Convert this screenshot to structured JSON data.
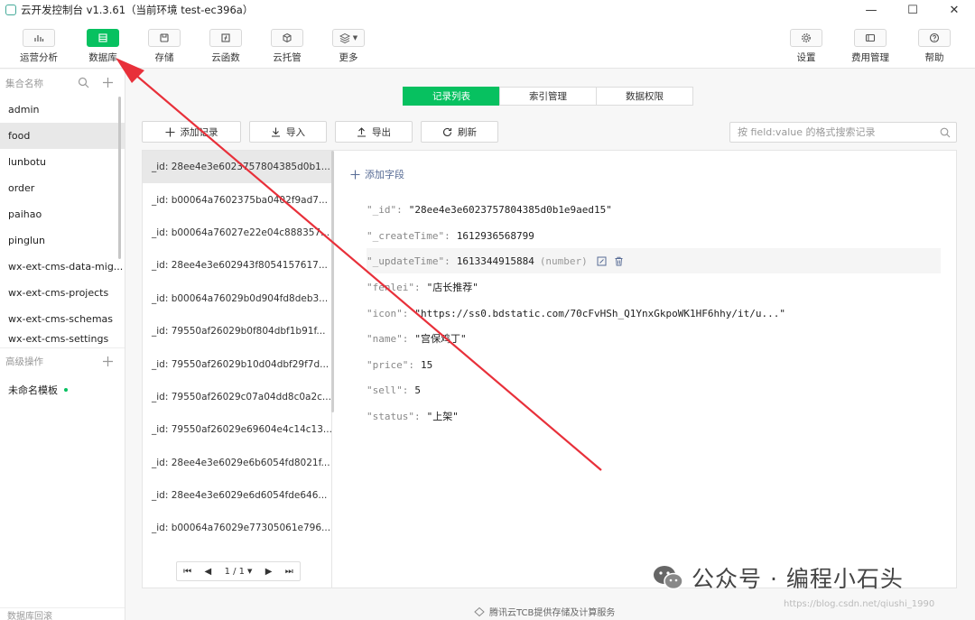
{
  "window": {
    "title": "云开发控制台 v1.3.61（当前环境 test-ec396a）",
    "minimize": "—",
    "maximize": "☐",
    "close": "✕"
  },
  "toolbar": {
    "left": [
      {
        "label": "运营分析",
        "icon": "bar-chart-icon"
      },
      {
        "label": "数据库",
        "icon": "database-icon",
        "active": true
      },
      {
        "label": "存储",
        "icon": "storage-icon"
      },
      {
        "label": "云函数",
        "icon": "function-icon"
      },
      {
        "label": "云托管",
        "icon": "cube-icon"
      },
      {
        "label": "更多",
        "icon": "layers-icon"
      }
    ],
    "right": [
      {
        "label": "设置",
        "icon": "gear-icon"
      },
      {
        "label": "费用管理",
        "icon": "wallet-icon"
      },
      {
        "label": "帮助",
        "icon": "help-icon"
      }
    ]
  },
  "sidebar": {
    "collections_header": "集合名称",
    "collections": [
      "admin",
      "food",
      "lunbotu",
      "order",
      "paihao",
      "pinglun",
      "wx-ext-cms-data-mig...",
      "wx-ext-cms-projects",
      "wx-ext-cms-schemas",
      "wx-ext-cms-settings"
    ],
    "active_collection": "food",
    "advanced_header": "高级操作",
    "templates": [
      "未命名模板"
    ],
    "footer": "数据库回滚"
  },
  "tabs": [
    "记录列表",
    "索引管理",
    "数据权限"
  ],
  "actions": {
    "add": "添加记录",
    "import": "导入",
    "export": "导出",
    "refresh": "刷新"
  },
  "search": {
    "placeholder": "按 field:value 的格式搜索记录"
  },
  "records": [
    "_id: 28ee4e3e6023757804385d0b1...",
    "_id: b00064a7602375ba0402f9ad7...",
    "_id: b00064a76027e22e04c888357...",
    "_id: 28ee4e3e602943f8054157617...",
    "_id: b00064a76029b0d904fd8deb3...",
    "_id: 79550af26029b0f804dbf1b91f...",
    "_id: 79550af26029b10d04dbf29f7d...",
    "_id: 79550af26029c07a04dd8c0a2c...",
    "_id: 79550af26029e69604e4c14c13...",
    "_id: 28ee4e3e6029e6b6054fd8021f...",
    "_id: 28ee4e3e6029e6d6054fde646...",
    "_id: b00064a76029e77305061e796..."
  ],
  "pager": {
    "first": "⏮",
    "prev": "◀",
    "page": "1 / 1",
    "next": "▶",
    "last": "⏭"
  },
  "document": {
    "add_field": "添加字段",
    "fields": [
      {
        "key": "\"_id\":",
        "value": "\"28ee4e3e6023757804385d0b1e9aed15\""
      },
      {
        "key": "\"_createTime\":",
        "value": "1612936568799"
      },
      {
        "key": "\"_updateTime\":",
        "value": "1613344915884",
        "type": "(number)",
        "hover": true
      },
      {
        "key": "\"fenlei\":",
        "value": "\"店长推荐\""
      },
      {
        "key": "\"icon\":",
        "value": "\"https://ss0.bdstatic.com/70cFvHSh_Q1YnxGkpoWK1HF6hhy/it/u...\""
      },
      {
        "key": "\"name\":",
        "value": "\"宫保鸡丁\""
      },
      {
        "key": "\"price\":",
        "value": "15"
      },
      {
        "key": "\"sell\":",
        "value": "5"
      },
      {
        "key": "\"status\":",
        "value": "\"上架\""
      }
    ]
  },
  "footer_text": "腾讯云TCB提供存储及计算服务",
  "watermark": {
    "text": "公众号 · 编程小石头",
    "url": "https://blog.csdn.net/qiushi_1990"
  },
  "colors": {
    "accent": "#07c160",
    "arrow": "#e8303a"
  }
}
